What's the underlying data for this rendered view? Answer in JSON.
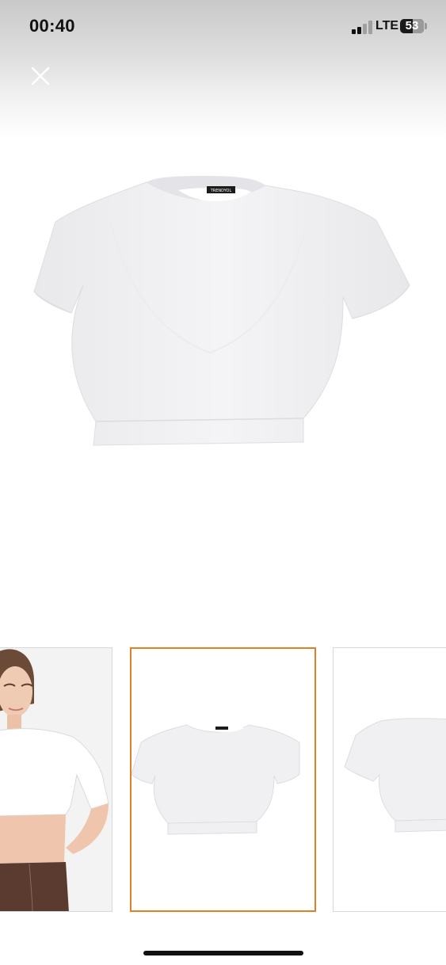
{
  "status_bar": {
    "time": "00:40",
    "network": "LTE",
    "battery_level": "53",
    "battery_fraction": 0.53,
    "signal_bars_active": 2,
    "signal_bars_total": 4
  },
  "toolbar": {
    "close_icon": "close-icon"
  },
  "main_image": {
    "product": "white short-sleeve crop top",
    "brand_label": "TRENDYOL"
  },
  "thumbnails": [
    {
      "content": "model wearing white crop top",
      "selected": false
    },
    {
      "content": "white crop top front view",
      "selected": true
    },
    {
      "content": "white crop top back view",
      "selected": false
    }
  ],
  "colors": {
    "selected_border": "#e27e26",
    "thumb_border": "#d8d8d8",
    "product": "#f1f1f3"
  }
}
